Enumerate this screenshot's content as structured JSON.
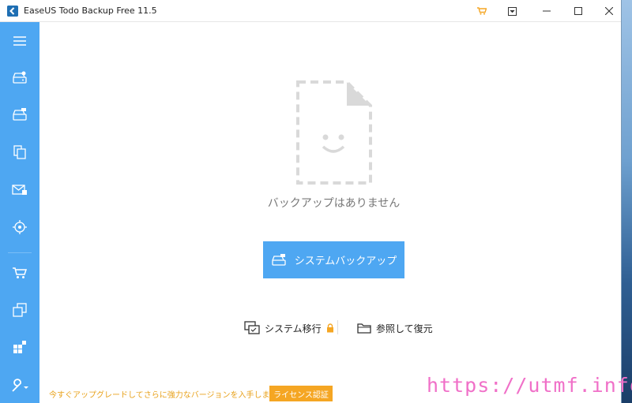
{
  "window": {
    "title": "EaseUS Todo Backup Free 11.5"
  },
  "titlebar_buttons": {
    "cart": "cart-icon",
    "menu": "dropdown-menu-icon",
    "minimize": "minimize-icon",
    "maximize": "maximize-icon",
    "close": "close-icon"
  },
  "sidebar": {
    "items": [
      {
        "name": "menu",
        "icon": "hamburger-icon"
      },
      {
        "name": "disk-backup",
        "icon": "disk-backup-icon"
      },
      {
        "name": "system-backup",
        "icon": "system-backup-icon"
      },
      {
        "name": "file-backup",
        "icon": "file-backup-icon"
      },
      {
        "name": "mail-backup",
        "icon": "mail-backup-icon"
      },
      {
        "name": "smart-backup",
        "icon": "target-icon"
      },
      {
        "name": "store",
        "icon": "cart-icon"
      },
      {
        "name": "clone",
        "icon": "clone-icon"
      },
      {
        "name": "windows",
        "icon": "windows-icon"
      },
      {
        "name": "tools",
        "icon": "wrench-icon"
      }
    ]
  },
  "main": {
    "empty_message": "バックアップはありません",
    "primary_button": "システムバックアップ",
    "link_system_transfer": "システム移行",
    "link_browse_restore": "参照して復元"
  },
  "footer": {
    "upgrade_text": "今すぐアップグレードしてさらに強力なバージョンを入手しましょう。",
    "license_button": "ライセンス認証"
  },
  "watermark": "https://utmf.info/",
  "colors": {
    "sidebar": "#4ea7f2",
    "accent": "#4ea7f2",
    "license": "#f5a623",
    "watermark": "#f070c8"
  }
}
